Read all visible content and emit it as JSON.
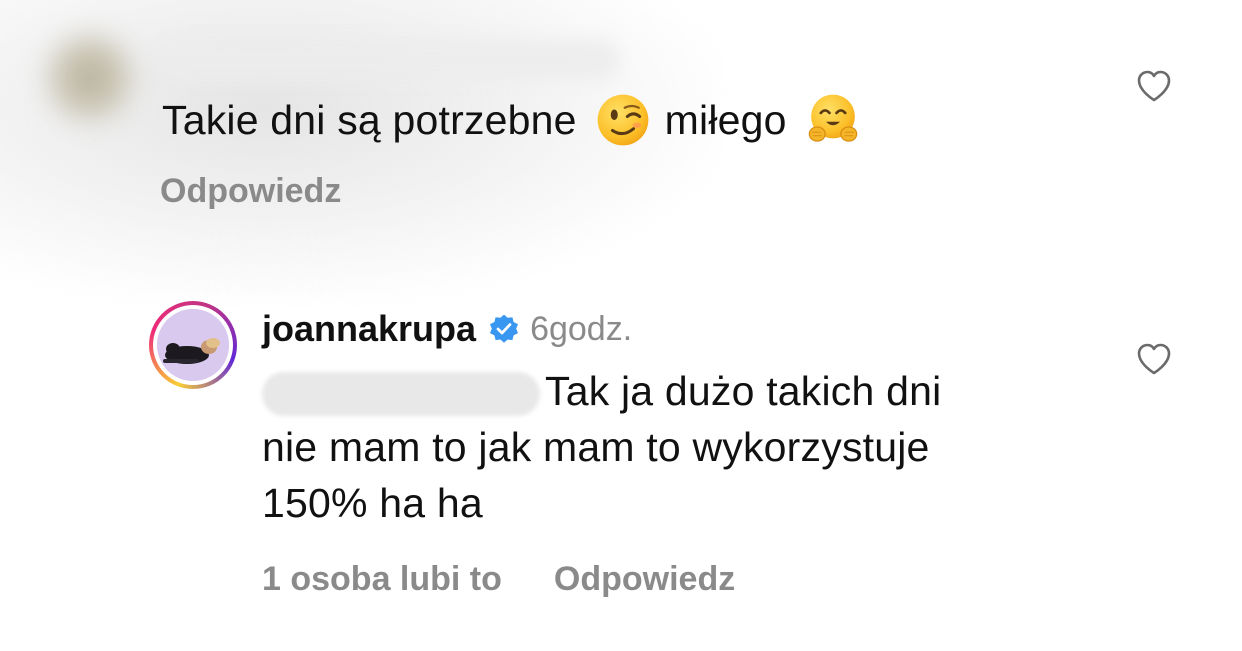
{
  "comment_1": {
    "text_part1": "Takie dni są potrzebne",
    "emoji_1": "winking-face",
    "text_part2": "miłego",
    "emoji_2": "hugging-face",
    "reply_label": "Odpowiedz",
    "liked": false
  },
  "comment_2": {
    "username": "joannakrupa",
    "verified": true,
    "time": "6godz.",
    "text_line1": "Tak ja dużo takich dni",
    "text_line2": "nie mam to jak mam to wykorzystuje",
    "text_line3": "150% ha ha",
    "likes_label": "1 osoba lubi to",
    "reply_label": "Odpowiedz",
    "liked": false
  },
  "colors": {
    "verified_blue": "#3897f0",
    "muted_text": "#8a8a8a",
    "heart_stroke": "#6b6b6b"
  }
}
